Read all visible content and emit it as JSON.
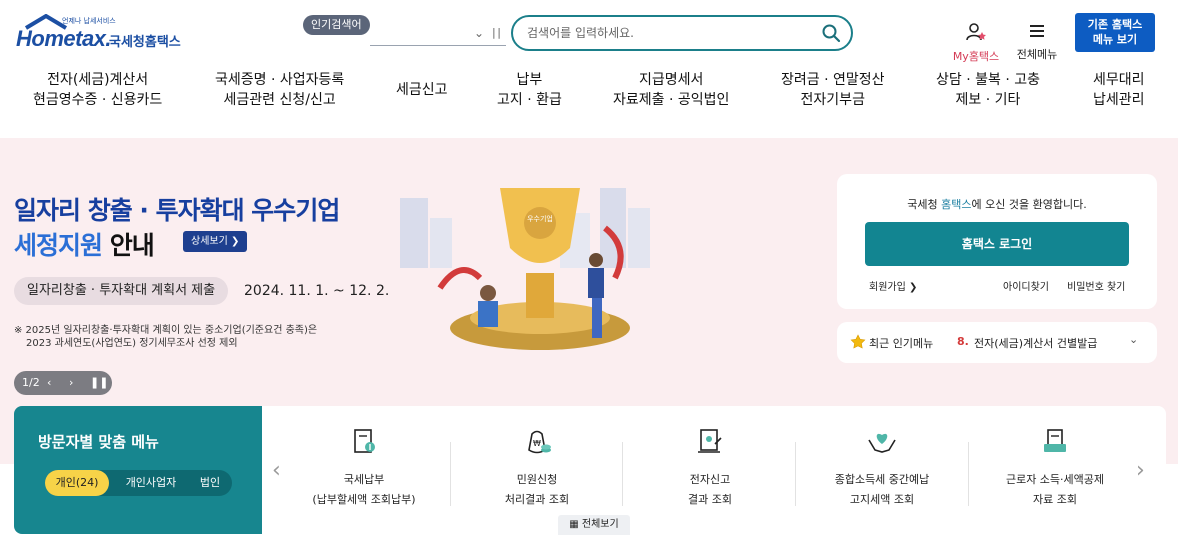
{
  "brand": {
    "logo_text": "Hometax.",
    "tagline": "언제나 납세서비스",
    "name_kr": "국세청홈택스",
    "primary_color": "#1c4fa3",
    "accent_color": "#128591"
  },
  "header": {
    "popular_badge": "인기검색어",
    "search_placeholder": "검색어를 입력하세요.",
    "my_hometax": "My홈택스",
    "all_menu": "전체메뉴",
    "basic_menu_line1": "기존 홈택스",
    "basic_menu_line2": "메뉴 보기"
  },
  "gnb": [
    {
      "line1": "전자(세금)계산서",
      "line2": "현금영수증 · 신용카드"
    },
    {
      "line1": "국세증명 · 사업자등록",
      "line2": "세금관련 신청/신고"
    },
    {
      "line1": "세금신고",
      "line2": ""
    },
    {
      "line1": "납부",
      "line2": "고지 · 환급"
    },
    {
      "line1": "지급명세서",
      "line2": "자료제출 · 공익법인"
    },
    {
      "line1": "장려금 · 연말정산",
      "line2": "전자기부금"
    },
    {
      "line1": "상담 · 불복 · 고충",
      "line2": "제보 · 기타"
    },
    {
      "line1": "세무대리",
      "line2": "납세관리"
    }
  ],
  "banner": {
    "title_line1": "일자리 창출 · 투자확대 우수기업",
    "title_line2_highlight": "세정지원",
    "title_line2_rest": " 안내",
    "detail_button": "상세보기 ❯",
    "pill": "일자리창출 · 투자확대 계획서 제출",
    "date": "2024. 11. 1. ~ 12. 2.",
    "note_line1": "※ 2025년 일자리창출·투자확대 계획이 있는 중소기업(기준요건 충족)은",
    "note_line2": "2023 과세연도(사업연도) 정기세무조사 선정 제외",
    "page_indicator": "1/2",
    "trophy_text": "우수기업"
  },
  "login": {
    "welcome_pre": "국세청 ",
    "welcome_hl": "홈택스",
    "welcome_post": "에 오신 것을 환영합니다.",
    "login_button": "홈택스 로그인",
    "signup": "회원가입 ❯",
    "find_id": "아이디찾기",
    "find_pw": "비밀번호 찾기"
  },
  "recent": {
    "label": "최근 인기메뉴",
    "rank": "8.",
    "item": "전자(세금)계산서 건별발급"
  },
  "visitor": {
    "title": "방문자별 맞춤 메뉴",
    "tabs": [
      "개인(24)",
      "개인사업자",
      "법인"
    ]
  },
  "menu_items": [
    {
      "line1": "국세납부",
      "line2": "(납부할세액 조회납부)",
      "icon": "tax-payment-icon"
    },
    {
      "line1": "민원신청",
      "line2": "처리결과 조회",
      "icon": "money-bag-icon"
    },
    {
      "line1": "전자신고",
      "line2": "결과 조회",
      "icon": "e-filing-icon"
    },
    {
      "line1": "종합소득세 중간예납",
      "line2": "고지세액 조회",
      "icon": "heart-hands-icon"
    },
    {
      "line1": "근로자 소득·세액공제",
      "line2": "자료 조회",
      "icon": "document-stack-icon"
    }
  ],
  "all_view": "전체보기"
}
